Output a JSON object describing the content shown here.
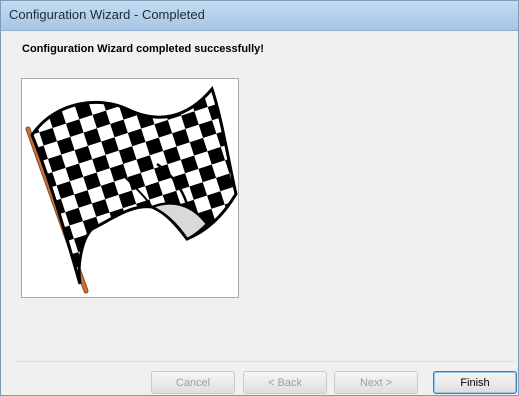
{
  "window": {
    "title": "Configuration Wizard - Completed"
  },
  "main": {
    "heading": "Configuration Wizard completed successfully!",
    "image_icon": "checkered-flag-icon"
  },
  "buttons": {
    "cancel_label": "Cancel",
    "back_label": "< Back",
    "next_label": "Next >",
    "finish_label": "Finish"
  }
}
